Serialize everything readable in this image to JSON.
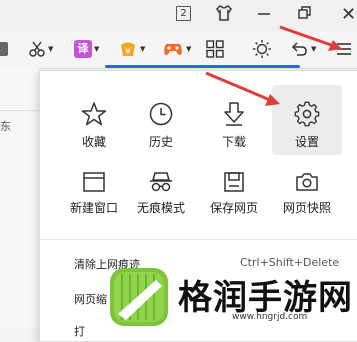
{
  "titlebar": {
    "tab_count": "2",
    "icons": [
      "tab-count-icon",
      "skin-shirt-icon",
      "minimize-icon",
      "restore-icon",
      "close-icon"
    ]
  },
  "toolbar": {
    "translate_label": "译",
    "icons": [
      "scissors-icon",
      "translate-icon",
      "money-icon",
      "game-controller-icon",
      "apps-grid-icon",
      "brightness-icon",
      "undo-icon",
      "menu-icon"
    ]
  },
  "left_page": {
    "fragment": "东"
  },
  "menu": {
    "top_row": [
      {
        "label": "收藏",
        "icon": "star-icon"
      },
      {
        "label": "历史",
        "icon": "clock-icon"
      },
      {
        "label": "下载",
        "icon": "download-icon"
      },
      {
        "label": "设置",
        "icon": "gear-icon"
      }
    ],
    "second_row": [
      {
        "label": "新建窗口",
        "icon": "new-window-icon"
      },
      {
        "label": "无痕模式",
        "icon": "incognito-icon"
      },
      {
        "label": "保存网页",
        "icon": "save-icon"
      },
      {
        "label": "网页快照",
        "icon": "camera-icon"
      }
    ],
    "rows": [
      {
        "label": "清除上网痕迹",
        "shortcut": "Ctrl+Shift+Delete"
      },
      {
        "label": "网页缩"
      },
      {
        "label": "打"
      }
    ]
  },
  "watermark": {
    "text": "格润手游网",
    "url": "www.hngrjd.com"
  },
  "colors": {
    "accent_blue": "#2a6cd6",
    "arrow_red": "#e23b3b",
    "translate_purple": "#c455d8",
    "logo_green": "#7cc43a"
  }
}
